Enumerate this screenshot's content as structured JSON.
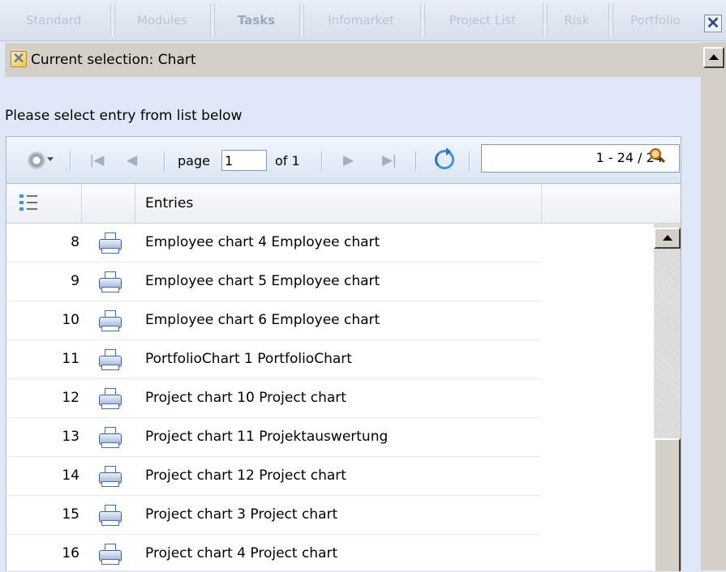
{
  "tabs": [
    {
      "label": "Standard",
      "active": false
    },
    {
      "label": "Modules",
      "active": false
    },
    {
      "label": "Tasks",
      "active": true
    },
    {
      "label": "Infomarket",
      "active": false
    },
    {
      "label": "Project List",
      "active": false
    },
    {
      "label": "Risk",
      "active": false
    },
    {
      "label": "Portfolio",
      "active": false
    }
  ],
  "tabbar": {
    "close_glyph": "✕",
    "close_icon": "close-icon"
  },
  "selection": {
    "text": "Current selection: Chart",
    "icon": "clear-selection-icon"
  },
  "prompt": "Please select entry from list below",
  "toolbar": {
    "settings_icon": "gear-icon",
    "page_label": "page",
    "page_value": "1",
    "of_label": "of 1",
    "search_value": "",
    "record_count": "1 - 24 / 24",
    "nav_icons": [
      "first-page-icon",
      "prev-page-icon",
      "next-page-icon",
      "last-page-icon",
      "refresh-icon",
      "search-icon"
    ]
  },
  "grid": {
    "columns": [
      {
        "key": "number",
        "label": "",
        "icon": "numbered-list-icon"
      },
      {
        "key": "type",
        "label": ""
      },
      {
        "key": "entry",
        "label": "Entries"
      }
    ],
    "rows": [
      {
        "number": "8",
        "icon": "printer-icon",
        "entry": "Employee chart 4 Employee chart"
      },
      {
        "number": "9",
        "icon": "printer-icon",
        "entry": "Employee chart 5 Employee chart"
      },
      {
        "number": "10",
        "icon": "printer-icon",
        "entry": "Employee chart 6 Employee chart"
      },
      {
        "number": "11",
        "icon": "printer-icon",
        "entry": "PortfolioChart 1 PortfolioChart"
      },
      {
        "number": "12",
        "icon": "printer-icon",
        "entry": "Project chart 10 Project chart"
      },
      {
        "number": "13",
        "icon": "printer-icon",
        "entry": "Project chart 11 Projektauswertung"
      },
      {
        "number": "14",
        "icon": "printer-icon",
        "entry": "Project chart 12 Project chart"
      },
      {
        "number": "15",
        "icon": "printer-icon",
        "entry": "Project chart 3 Project chart"
      },
      {
        "number": "16",
        "icon": "printer-icon",
        "entry": "Project chart 4 Project chart"
      }
    ]
  },
  "colors": {
    "accent": "#99bbe8",
    "background": "#dfe8f6",
    "selection_bar": "#d4d0c8"
  }
}
